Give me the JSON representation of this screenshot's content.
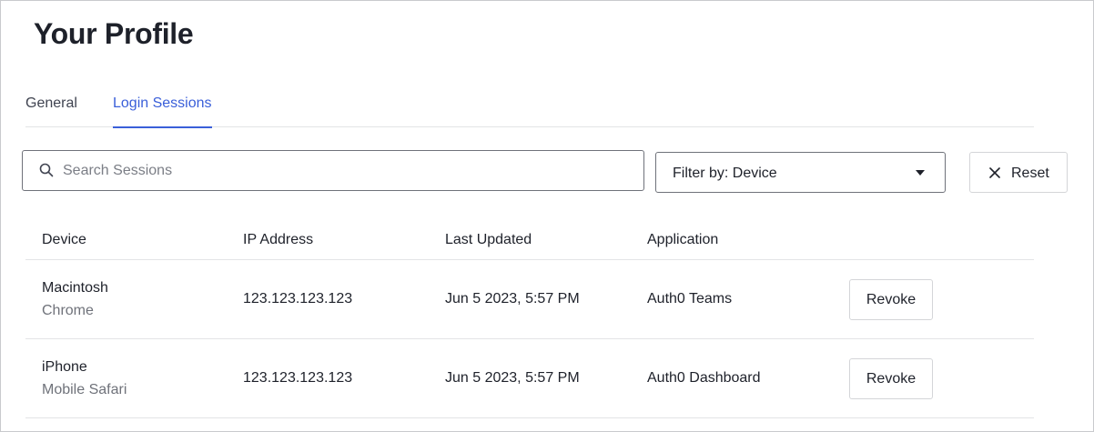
{
  "page": {
    "title": "Your Profile"
  },
  "tabs": [
    {
      "label": "General",
      "active": false
    },
    {
      "label": "Login Sessions",
      "active": true
    }
  ],
  "toolbar": {
    "search_placeholder": "Search Sessions",
    "search_value": "",
    "filter_label": "Filter by: Device",
    "reset_label": "Reset"
  },
  "table": {
    "headers": [
      "Device",
      "IP Address",
      "Last Updated",
      "Application"
    ],
    "rows": [
      {
        "device": "Macintosh",
        "browser": "Chrome",
        "ip": "123.123.123.123",
        "updated": "Jun 5 2023, 5:57 PM",
        "application": "Auth0 Teams",
        "action": "Revoke"
      },
      {
        "device": "iPhone",
        "browser": "Mobile Safari",
        "ip": "123.123.123.123",
        "updated": "Jun 5 2023, 5:57 PM",
        "application": "Auth0 Dashboard",
        "action": "Revoke"
      }
    ]
  },
  "colors": {
    "accent": "#3a5fd9",
    "border": "#6f727a",
    "divider": "#e3e4e6",
    "text": "#1e212a",
    "muted": "#6f727a"
  },
  "icons": {
    "search": "search-icon",
    "filter_caret": "caret-down-icon",
    "reset": "close-icon"
  }
}
